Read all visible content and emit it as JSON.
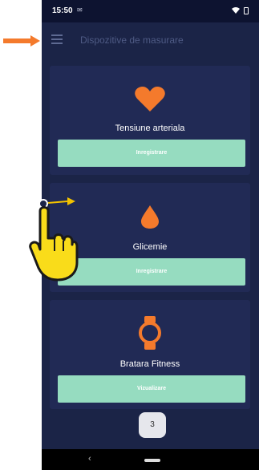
{
  "status_bar": {
    "time": "15:50",
    "mail_icon": "mail-icon",
    "wifi_icon": "wifi-icon",
    "battery_icon": "battery-icon"
  },
  "app_bar": {
    "menu_icon": "hamburger-menu-icon",
    "title": "Dispozitive de masurare"
  },
  "cards": [
    {
      "icon": "heart-icon",
      "title": "Tensiune arteriala",
      "button": "Inregistrare"
    },
    {
      "icon": "drop-icon",
      "title": "Glicemie",
      "button": "Inregistrare"
    },
    {
      "icon": "watch-icon",
      "title": "Bratara Fitness",
      "button": "Vizualizare"
    }
  ],
  "page_indicator": "3",
  "nav_bar": {
    "back_icon": "back-chevron-icon",
    "home_icon": "home-pill-icon"
  },
  "annotations": {
    "menu_arrow": "orange-arrow-icon",
    "swipe_hand": "hand-pointer-icon"
  },
  "colors": {
    "background": "#1b2447",
    "card": "#212a55",
    "accent_orange": "#f47a2c",
    "button_green": "#96dcc0"
  }
}
